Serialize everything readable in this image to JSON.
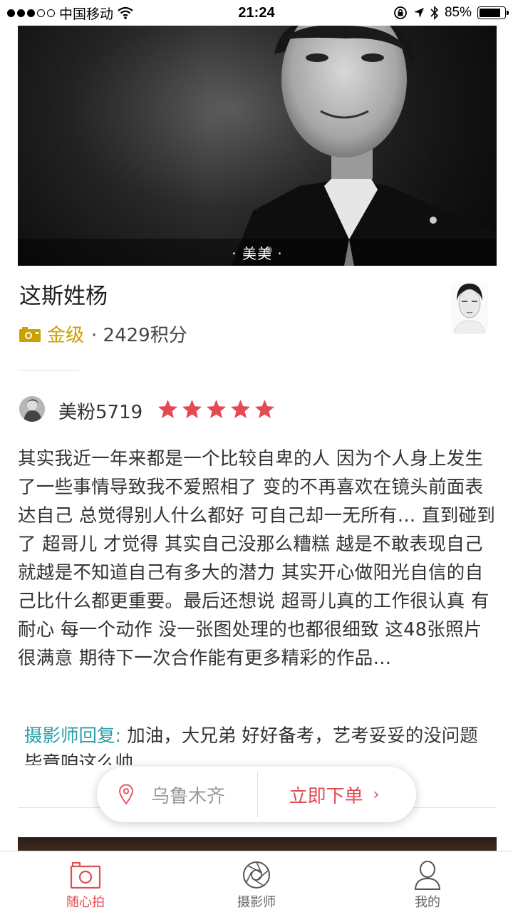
{
  "status_bar": {
    "carrier": "中国移动",
    "time": "21:24",
    "battery": "85%",
    "battery_level": 0.85
  },
  "hero": {
    "caption": "· 美美 ·"
  },
  "photographer": {
    "name": "这斯姓杨",
    "level": "金级",
    "points": "· 2429积分"
  },
  "review": {
    "reviewer": "美粉5719",
    "rating": 5,
    "text": "其实我近一年来都是一个比较自卑的人 因为个人身上发生了一些事情导致我不爱照相了 变的不再喜欢在镜头前面表达自己 总觉得别人什么都好 可自己却一无所有… 直到碰到了 超哥儿 才觉得 其实自己没那么糟糕 越是不敢表现自己就越是不知道自己有多大的潜力  其实开心做阳光自信的自己比什么都更重要。最后还想说 超哥儿真的工作很认真 有耐心 每一个动作 没一张图处理的也都很细致 这48张照片很满意 期待下一次合作能有更多精彩的作品…",
    "reply_label": "摄影师回复:",
    "reply_text": " 加油，大兄弟  好好备考，艺考妥妥的没问题 毕竟咱这么帅"
  },
  "float_bar": {
    "location": "乌鲁木齐",
    "order_label": "立即下单",
    "order_chevron": "›"
  },
  "tabs": [
    {
      "label": "随心拍",
      "icon": "camera-icon",
      "active": true
    },
    {
      "label": "摄影师",
      "icon": "aperture-icon",
      "active": false
    },
    {
      "label": "我的",
      "icon": "person-icon",
      "active": false
    }
  ],
  "colors": {
    "accent": "#e34b52",
    "gold": "#c9a100",
    "reply_label": "#2aa0a8"
  }
}
